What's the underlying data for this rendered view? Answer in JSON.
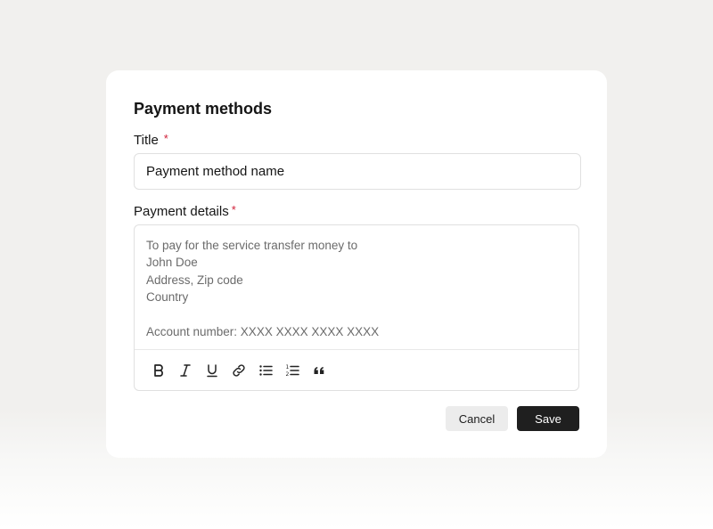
{
  "dialog": {
    "title": "Payment methods",
    "title_field": {
      "label": "Title",
      "required_mark": "*",
      "value": "Payment method name"
    },
    "details_field": {
      "label": "Payment details",
      "required_mark": "*",
      "lines": [
        "To pay for the service transfer money to",
        "John Doe",
        "Address, Zip code",
        "Country",
        "",
        "Account number: XXXX XXXX XXXX XXXX"
      ]
    },
    "toolbar": [
      "bold-icon",
      "italic-icon",
      "underline-icon",
      "link-icon",
      "bullet-list-icon",
      "numbered-list-icon",
      "quote-icon"
    ],
    "cancel_label": "Cancel",
    "save_label": "Save"
  },
  "colors": {
    "required": "#d0213a",
    "primary_button": "#1f1f1f",
    "secondary_button": "#ececec",
    "background": "#f1f0ee"
  }
}
